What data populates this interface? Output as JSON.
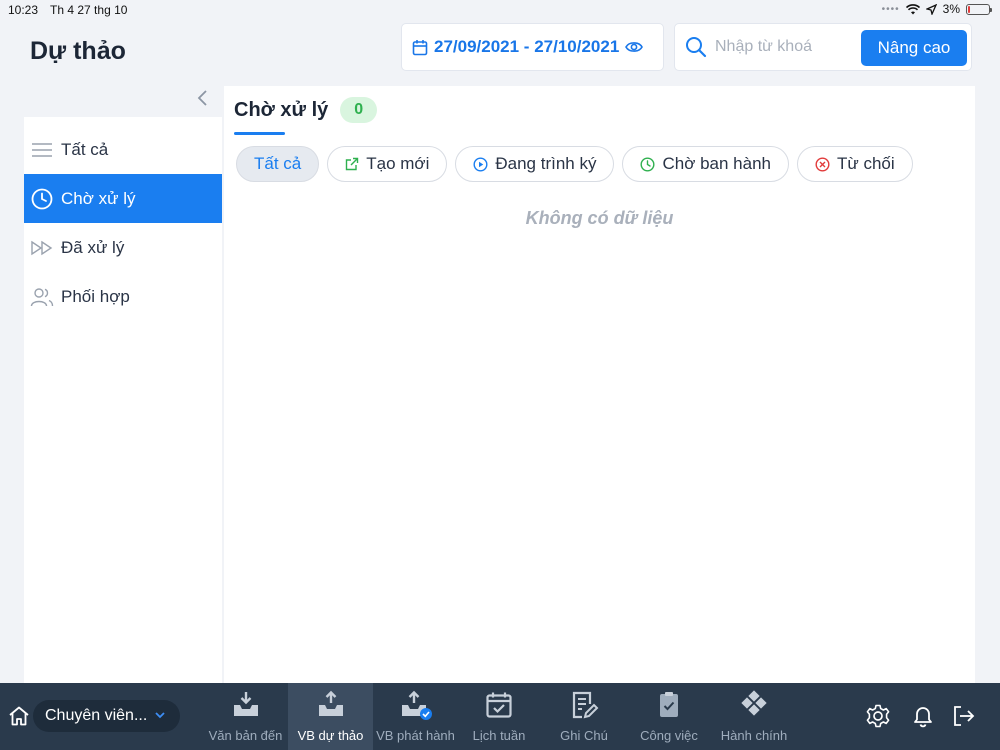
{
  "status": {
    "time": "10:23",
    "date": "Th 4 27 thg 10",
    "battery": "3%"
  },
  "header": {
    "title": "Dự thảo",
    "date_range": "27/09/2021 - 27/10/2021",
    "search_placeholder": "Nhập từ khoá",
    "advanced_label": "Nâng cao"
  },
  "sidebar": {
    "items": [
      {
        "label": "Tất cả",
        "icon": "menu-icon"
      },
      {
        "label": "Chờ xử lý",
        "icon": "clock-icon"
      },
      {
        "label": "Đã xử lý",
        "icon": "fast-forward-icon"
      },
      {
        "label": "Phối hợp",
        "icon": "users-icon"
      }
    ],
    "active_index": 1
  },
  "main": {
    "title": "Chờ xử lý",
    "count": "0",
    "filters": [
      {
        "label": "Tất cả",
        "icon": ""
      },
      {
        "label": "Tạo mới",
        "icon": "external-link-icon",
        "color": "#2fb04f"
      },
      {
        "label": "Đang trình ký",
        "icon": "play-circle-icon",
        "color": "#1a7ef0"
      },
      {
        "label": "Chờ ban hành",
        "icon": "clock-icon",
        "color": "#2fb04f"
      },
      {
        "label": "Từ chối",
        "icon": "x-circle-icon",
        "color": "#e23b3b"
      }
    ],
    "empty_text": "Không có dữ liệu"
  },
  "bottom": {
    "role": "Chuyên viên...",
    "nav": [
      {
        "label": "Văn bản đến",
        "icon": "inbox-in-icon"
      },
      {
        "label": "VB dự thảo",
        "icon": "inbox-out-icon"
      },
      {
        "label": "VB phát hành",
        "icon": "inbox-published-icon"
      },
      {
        "label": "Lịch tuần",
        "icon": "calendar-check-icon"
      },
      {
        "label": "Ghi Chú",
        "icon": "note-edit-icon"
      },
      {
        "label": "Công việc",
        "icon": "clipboard-check-icon"
      },
      {
        "label": "Hành chính",
        "icon": "diamond-grid-icon"
      }
    ],
    "active_index": 1
  },
  "colors": {
    "accent": "#1a7ef0",
    "bottom_bar": "#2a3a4c",
    "badge_bg": "#d9f5df",
    "badge_text": "#2fb04f"
  }
}
